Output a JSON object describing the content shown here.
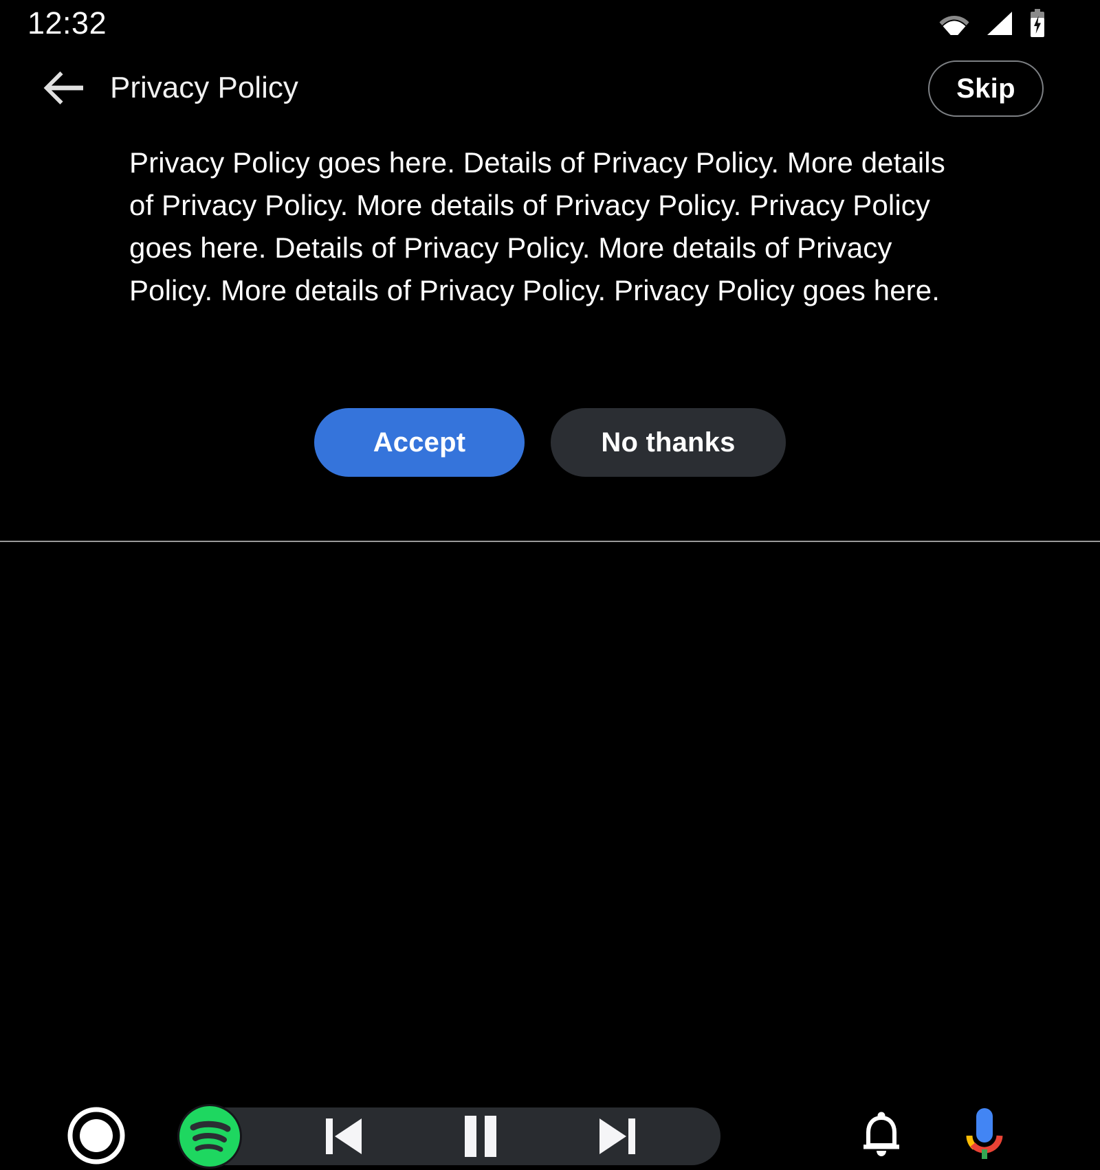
{
  "status_bar": {
    "clock": "12:32",
    "icons": [
      {
        "name": "wifi-icon",
        "label": "Wi-Fi"
      },
      {
        "name": "cellular-signal-icon",
        "label": "Cellular signal"
      },
      {
        "name": "battery-charging-icon",
        "label": "Battery charging"
      }
    ]
  },
  "header": {
    "back_icon": "arrow-left-icon",
    "title": "Privacy Policy",
    "skip_label": "Skip"
  },
  "content": {
    "policy_text": "Privacy Policy goes here. Details of Privacy Policy. More details of Privacy Policy. More details of Privacy Policy. Privacy Policy goes here. Details of Privacy Policy. More details of Privacy Policy. More details of Privacy Policy. Privacy Policy goes here.",
    "accept_label": "Accept",
    "decline_label": "No thanks"
  },
  "nav_bar": {
    "home_icon": "home-circle-icon",
    "media_app": "spotify-logo-icon",
    "prev_icon": "skip-previous-icon",
    "play_pause_icon": "pause-icon",
    "next_icon": "skip-next-icon",
    "notification_icon": "bell-icon",
    "assistant_icon": "google-assistant-mic-icon"
  },
  "colors": {
    "background": "#000000",
    "accept_blue": "#3574db",
    "decline_gray": "#2b2e33",
    "media_pill": "#292c30",
    "spotify_green": "#1ed760",
    "divider": "#9a9a9a",
    "skip_border": "#7d8084",
    "assistant_blue": "#4285f4",
    "assistant_yellow": "#fbbc05",
    "assistant_red": "#ea4335",
    "assistant_green": "#34a853"
  }
}
